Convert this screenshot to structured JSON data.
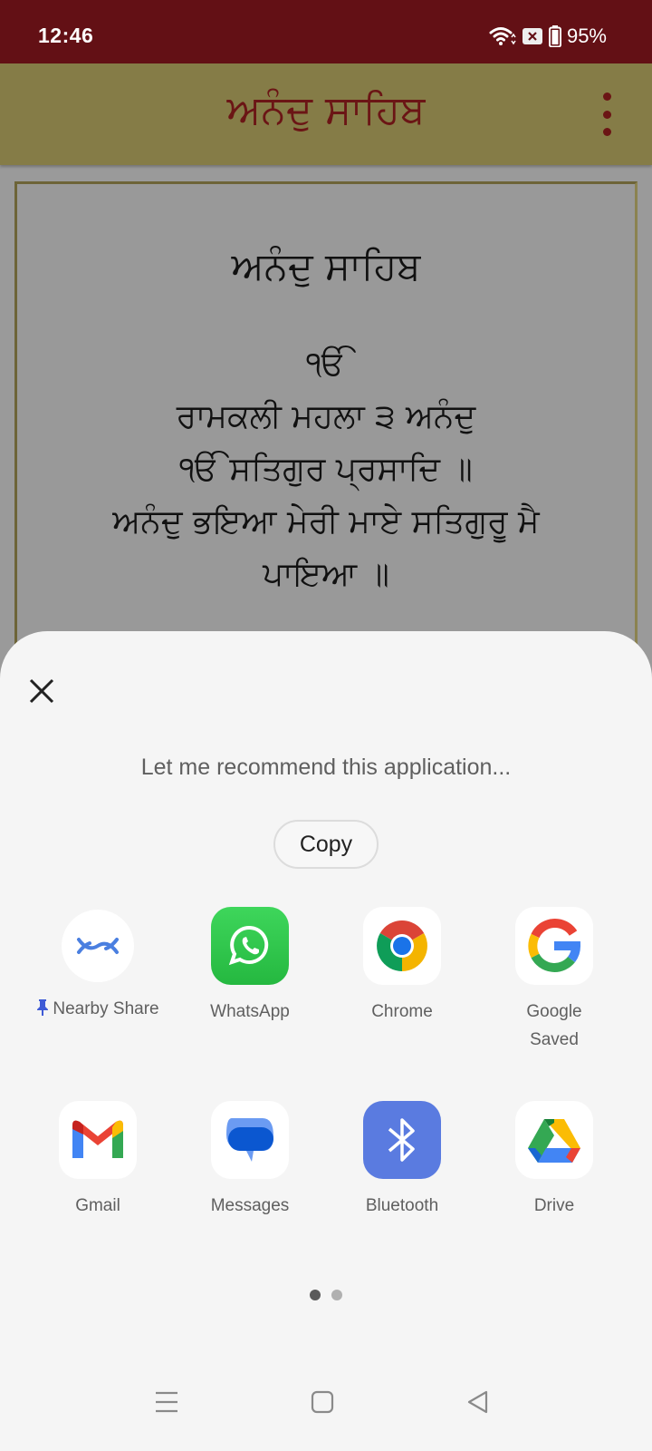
{
  "status_bar": {
    "time": "12:46",
    "battery_percent": "95%",
    "icons": [
      "wifi-icon",
      "no-sim-icon",
      "battery-icon"
    ]
  },
  "app_bar": {
    "title": "ਅਨੰਦੁ ਸਾਹਿਬ",
    "menu_icon": "more-vert-icon"
  },
  "content": {
    "title": "ਅਨੰਦੁ ਸਾਹਿਬ",
    "lines": [
      "ੴ",
      "ਰਾਮਕਲੀ ਮਹਲਾ ੩ ਅਨੰਦੁ",
      "ੴ ਸਤਿਗੁਰ ਪ੍ਰਸਾਦਿ ॥",
      "ਅਨੰਦੁ ਭਇਆ ਮੇਰੀ ਮਾਏ ਸਤਿਗੁਰੂ ਮੈ",
      "ਪਾਇਆ ॥"
    ]
  },
  "share_sheet": {
    "close_icon": "close-icon",
    "share_text": "Let me recommend this application...",
    "copy_label": "Copy",
    "apps": [
      {
        "label": "Nearby Share",
        "icon": "nearby-share-icon",
        "pinned": true
      },
      {
        "label": "WhatsApp",
        "icon": "whatsapp-icon"
      },
      {
        "label": "Chrome",
        "icon": "chrome-icon"
      },
      {
        "label": "Google\nSaved",
        "label_line1": "Google",
        "label_line2": "Saved",
        "icon": "google-icon"
      },
      {
        "label": "Gmail",
        "icon": "gmail-icon"
      },
      {
        "label": "Messages",
        "icon": "messages-icon"
      },
      {
        "label": "Bluetooth",
        "icon": "bluetooth-icon"
      },
      {
        "label": "Drive",
        "icon": "drive-icon"
      }
    ],
    "pagination": {
      "current_page": 1,
      "total_pages": 2
    }
  },
  "nav_bar": {
    "buttons": [
      "menu-icon",
      "home-icon",
      "back-icon"
    ]
  },
  "colors": {
    "status_bar": "#631015",
    "app_bar": "#857c47",
    "title_text": "#6b1515",
    "sheet_bg": "#f5f5f5",
    "dot_active": "#5a5a5a",
    "dot_inactive": "#b0b0b0"
  }
}
